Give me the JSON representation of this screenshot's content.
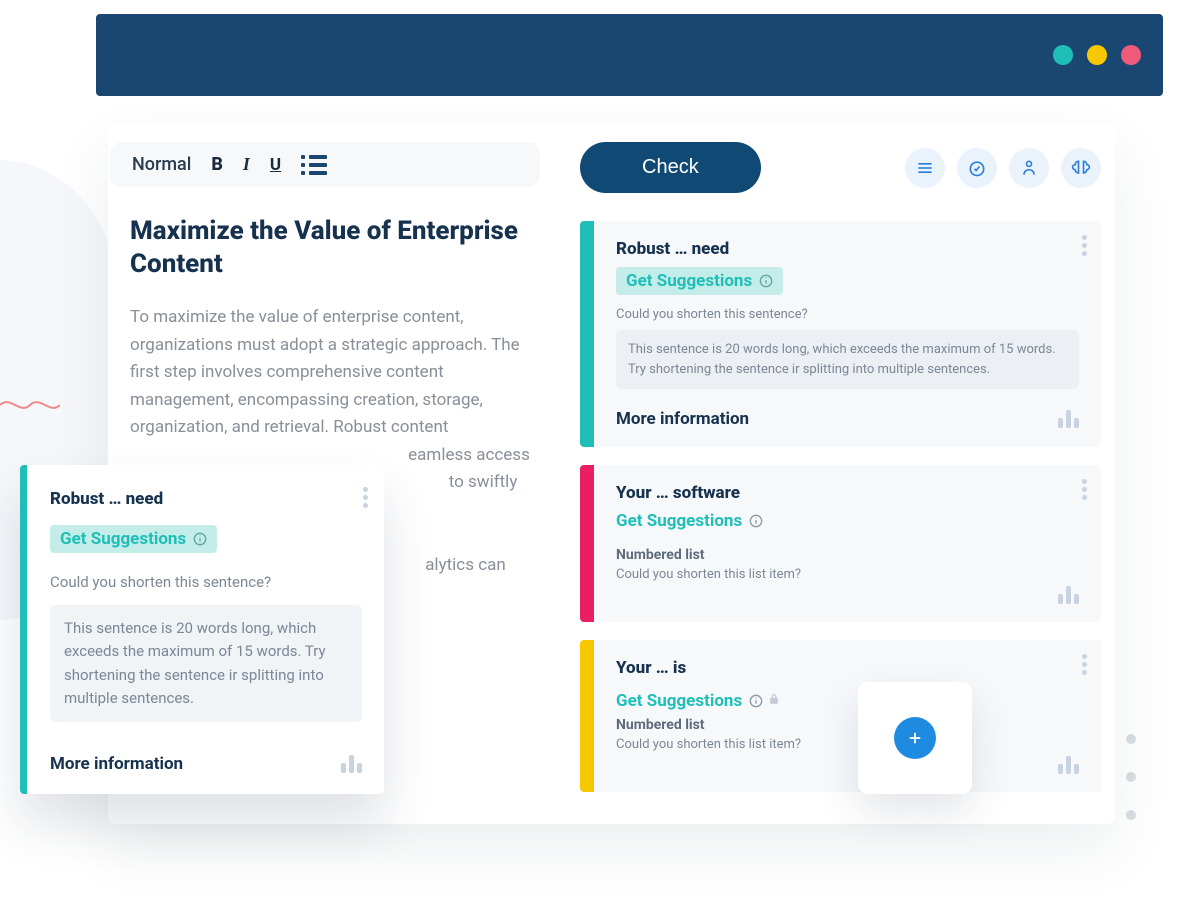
{
  "colors": {
    "navy": "#1a4772",
    "teal": "#1fbfb8",
    "pink": "#ea1e63",
    "yellow": "#f7c800",
    "blue_icon": "#2f81d6",
    "fab": "#1f8be0"
  },
  "toolbar": {
    "style_label": "Normal"
  },
  "check_button": "Check",
  "document": {
    "title": "Maximize the Value of Enterprise Content",
    "para1_a": "To maximize the value of enterprise content, organizations must adopt a strategic approach. The first step involves comprehensive content management, encompassing creation, storage, organization, and retrieval. Robust content ",
    "para1_b": "eamless access to ",
    "para1_c": " to swiftly locate and ",
    "para2": "alytics can unveil"
  },
  "popout": {
    "title": "Robust … need",
    "badge": "Get Suggestions",
    "prompt": "Could you shorten this sentence?",
    "detail": "This sentence is 20 words long, which exceeds the maximum of 15 words. Try shortening the sentence ir splitting into multiple sentences.",
    "more": "More information"
  },
  "cards": [
    {
      "stripe": "teal",
      "title": "Robust … need",
      "badge": "Get Suggestions",
      "badge_highlight": true,
      "prompt": "Could you shorten this sentence?",
      "detail": "This sentence is 20 words long, which exceeds the maximum of 15 words. Try shortening the sentence ir splitting into multiple sentences.",
      "more": "More information"
    },
    {
      "stripe": "pink",
      "title": "Your … software",
      "badge": "Get Suggestions",
      "subhead": "Numbered list",
      "prompt": "Could you shorten this list item?"
    },
    {
      "stripe": "yellow",
      "title": "Your … is",
      "badge": "Get Suggestions",
      "locked": true,
      "subhead": "Numbered list",
      "prompt": "Could you shorten this list item?"
    }
  ]
}
